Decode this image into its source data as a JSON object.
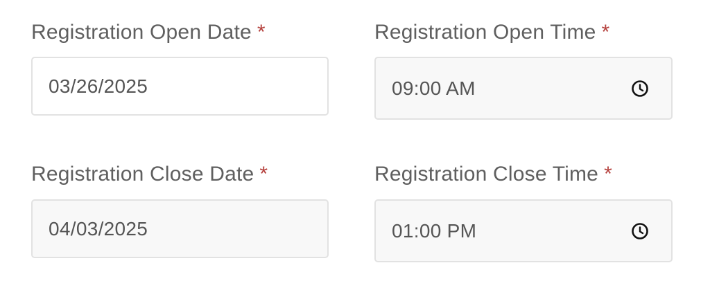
{
  "open_date": {
    "label": "Registration Open Date",
    "required_mark": "*",
    "value": "03/26/2025"
  },
  "open_time": {
    "label": "Registration Open Time",
    "required_mark": "*",
    "value": "09:00 AM",
    "icon": "clock-icon"
  },
  "close_date": {
    "label": "Registration Close Date",
    "required_mark": "*",
    "value": "04/03/2025"
  },
  "close_time": {
    "label": "Registration Close Time",
    "required_mark": "*",
    "value": "01:00 PM",
    "icon": "clock-icon"
  },
  "colors": {
    "required": "#b5413d",
    "label": "#5f5f5f",
    "input_border": "#e2e2e2",
    "input_filled_bg": "#f8f8f8"
  }
}
